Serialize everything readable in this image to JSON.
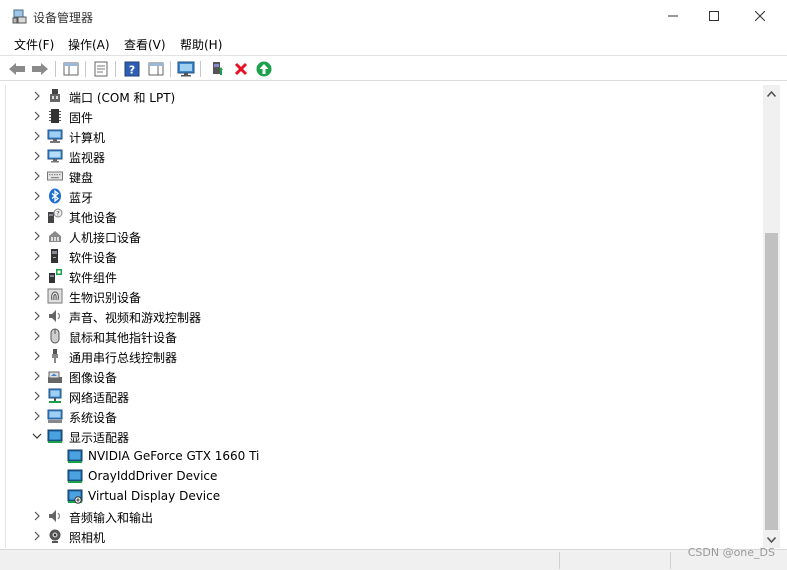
{
  "window": {
    "title": "设备管理器"
  },
  "menu": [
    {
      "label": "文件(F)"
    },
    {
      "label": "操作(A)"
    },
    {
      "label": "查看(V)"
    },
    {
      "label": "帮助(H)"
    }
  ],
  "tree": [
    {
      "label": "端口 (COM 和 LPT)",
      "icon": "port-icon",
      "expanded": false
    },
    {
      "label": "固件",
      "icon": "firmware-icon",
      "expanded": false
    },
    {
      "label": "计算机",
      "icon": "computer-icon",
      "expanded": false
    },
    {
      "label": "监视器",
      "icon": "monitor-icon",
      "expanded": false
    },
    {
      "label": "键盘",
      "icon": "keyboard-icon",
      "expanded": false
    },
    {
      "label": "蓝牙",
      "icon": "bluetooth-icon",
      "expanded": false
    },
    {
      "label": "其他设备",
      "icon": "unknown-device-icon",
      "expanded": false
    },
    {
      "label": "人机接口设备",
      "icon": "hid-icon",
      "expanded": false
    },
    {
      "label": "软件设备",
      "icon": "software-device-icon",
      "expanded": false
    },
    {
      "label": "软件组件",
      "icon": "software-component-icon",
      "expanded": false
    },
    {
      "label": "生物识别设备",
      "icon": "fingerprint-icon",
      "expanded": false
    },
    {
      "label": "声音、视频和游戏控制器",
      "icon": "speaker-icon",
      "expanded": false
    },
    {
      "label": "鼠标和其他指针设备",
      "icon": "mouse-icon",
      "expanded": false
    },
    {
      "label": "通用串行总线控制器",
      "icon": "usb-icon",
      "expanded": false
    },
    {
      "label": "图像设备",
      "icon": "camera-device-icon",
      "expanded": false
    },
    {
      "label": "网络适配器",
      "icon": "network-adapter-icon",
      "expanded": false
    },
    {
      "label": "系统设备",
      "icon": "system-device-icon",
      "expanded": false
    },
    {
      "label": "显示适配器",
      "icon": "display-adapter-icon",
      "expanded": true
    },
    {
      "label": "NVIDIA GeForce GTX 1660 Ti",
      "icon": "display-adapter-icon",
      "child": true
    },
    {
      "label": "OrayIddDriver Device",
      "icon": "display-adapter-icon",
      "child": true
    },
    {
      "label": "Virtual Display Device",
      "icon": "display-adapter-disabled-icon",
      "child": true
    },
    {
      "label": "音频输入和输出",
      "icon": "speaker-icon",
      "expanded": false
    },
    {
      "label": "照相机",
      "icon": "webcam-icon",
      "expanded": false
    }
  ],
  "watermark": "CSDN @one_DS",
  "colors": {
    "accent": "#0078d7",
    "delete": "#e81123",
    "update": "#1aa14a"
  }
}
